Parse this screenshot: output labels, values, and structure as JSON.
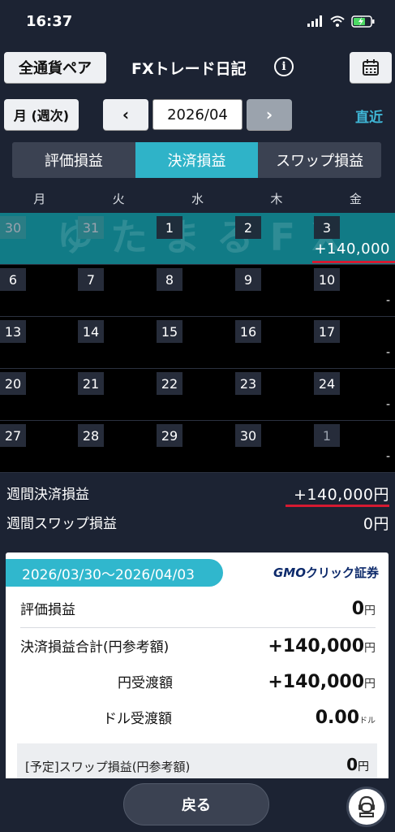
{
  "status": {
    "time": "16:37"
  },
  "header": {
    "currency_button": "全通貨ペア",
    "title": "FXトレード日記",
    "info_glyph": "i"
  },
  "nav": {
    "week_button": "月 (週次)",
    "prev_glyph": "‹",
    "month": "2026/04",
    "next_glyph": "›",
    "latest_link": "直近"
  },
  "tabs": [
    {
      "label": "評価損益",
      "active": false
    },
    {
      "label": "決済損益",
      "active": true
    },
    {
      "label": "スワップ損益",
      "active": false
    }
  ],
  "weekdays": [
    "月",
    "火",
    "水",
    "木",
    "金"
  ],
  "watermark": "ゆたまるFX",
  "weeks": [
    {
      "days": [
        "30",
        "31",
        "1",
        "2",
        "3"
      ],
      "other_month": [
        true,
        true,
        false,
        false,
        false
      ],
      "result": "+140,000",
      "highlight": true
    },
    {
      "days": [
        "6",
        "7",
        "8",
        "9",
        "10"
      ],
      "other_month": [
        false,
        false,
        false,
        false,
        false
      ],
      "result": "-",
      "highlight": false
    },
    {
      "days": [
        "13",
        "14",
        "15",
        "16",
        "17"
      ],
      "other_month": [
        false,
        false,
        false,
        false,
        false
      ],
      "result": "-",
      "highlight": false
    },
    {
      "days": [
        "20",
        "21",
        "22",
        "23",
        "24"
      ],
      "other_month": [
        false,
        false,
        false,
        false,
        false
      ],
      "result": "-",
      "highlight": false
    },
    {
      "days": [
        "27",
        "28",
        "29",
        "30",
        "1"
      ],
      "other_month": [
        false,
        false,
        false,
        false,
        true
      ],
      "result": "-",
      "highlight": false
    }
  ],
  "summary": {
    "settled_label": "週間決済損益",
    "settled_value": "+140,000円",
    "swap_label": "週間スワップ損益",
    "swap_value": "0円"
  },
  "card": {
    "date_range": "2026/03/30～2026/04/03",
    "brand_gmo": "GMO",
    "brand_click": "クリック",
    "brand_rest": "証券",
    "rows": [
      {
        "label": "評価損益",
        "value": "0",
        "unit": "円"
      },
      {
        "label": "決済損益合計(円参考額)",
        "value": "+140,000",
        "unit": "円"
      },
      {
        "label": "円受渡額",
        "value": "+140,000",
        "unit": "円"
      },
      {
        "label": "ドル受渡額",
        "value": "0.00",
        "unit": "ドル"
      }
    ],
    "pending_label": "[予定]スワップ損益(円参考額)",
    "pending_value": "0",
    "pending_unit": "円"
  },
  "bottom": {
    "back_button": "戻る"
  },
  "colors": {
    "accent": "#2fb3c8",
    "underline_red": "#d51a31",
    "background": "#1c2333"
  }
}
